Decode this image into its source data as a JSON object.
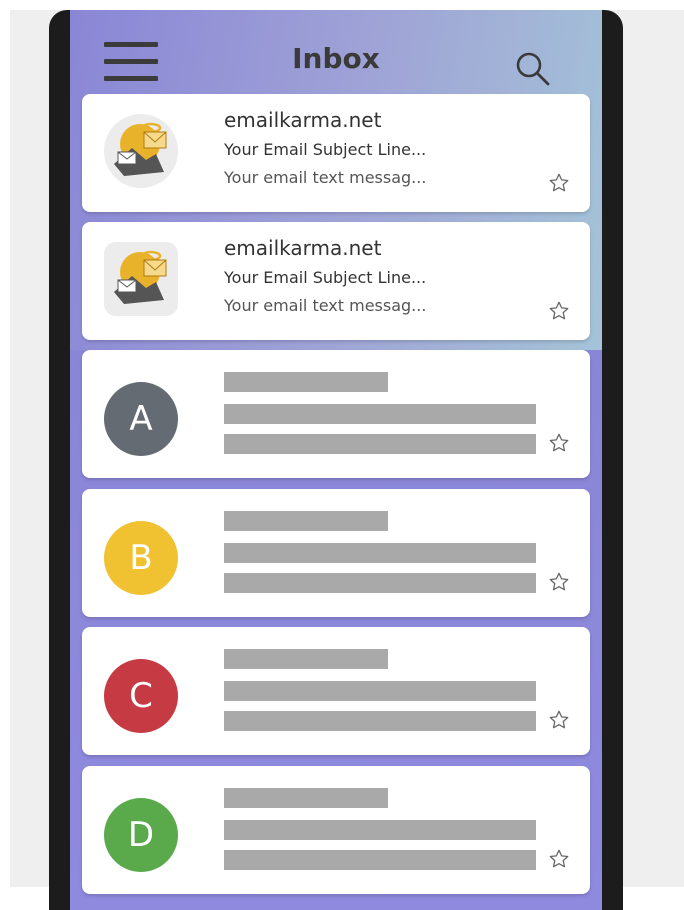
{
  "header": {
    "title": "Inbox"
  },
  "email_items": [
    {
      "sender": "emailkarma.net",
      "subject": "Your Email Subject Line...",
      "preview": "Your email text messag..."
    },
    {
      "sender": "emailkarma.net",
      "subject": "Your Email Subject Line...",
      "preview": "Your email text messag..."
    }
  ],
  "placeholder_items": [
    {
      "initial": "A",
      "color": "#656b73"
    },
    {
      "initial": "B",
      "color": "#f0c232"
    },
    {
      "initial": "C",
      "color": "#c63a44"
    },
    {
      "initial": "D",
      "color": "#5aaa4c"
    }
  ],
  "icons": {
    "menu": "hamburger-menu-icon",
    "search": "search-icon",
    "star": "star-outline-icon",
    "brand": "emailkarma-logo-icon"
  },
  "colors": {
    "placeholder_bar": "#a9a9a9",
    "header_text": "#3a3a3a"
  }
}
